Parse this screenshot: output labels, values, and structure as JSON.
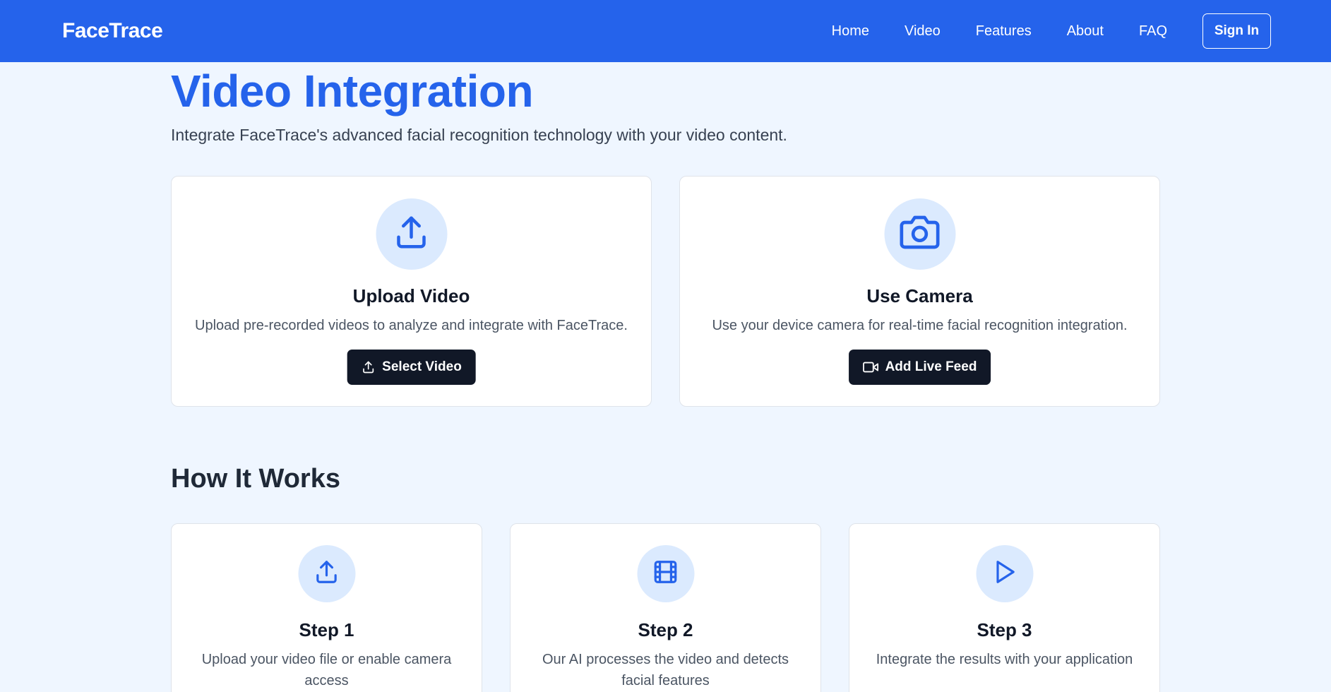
{
  "brand": "FaceTrace",
  "nav": {
    "links": [
      "Home",
      "Video",
      "Features",
      "About",
      "FAQ"
    ],
    "signin_label": "Sign In"
  },
  "header": {
    "title": "Video Integration",
    "subtitle": "Integrate FaceTrace's advanced facial recognition technology with your video content."
  },
  "options": {
    "upload": {
      "icon": "upload-icon",
      "title": "Upload Video",
      "description": "Upload pre-recorded videos to analyze and integrate with FaceTrace.",
      "button_label": "Select Video",
      "button_icon": "upload-icon"
    },
    "camera": {
      "icon": "camera-icon",
      "title": "Use Camera",
      "description": "Use your device camera for real-time facial recognition integration.",
      "button_label": "Add Live Feed",
      "button_icon": "video-camera-icon"
    }
  },
  "how_it_works": {
    "title": "How It Works",
    "steps": [
      {
        "icon": "upload-icon",
        "title": "Step 1",
        "description": "Upload your video file or enable camera access"
      },
      {
        "icon": "film-icon",
        "title": "Step 2",
        "description": "Our AI processes the video and detects facial features"
      },
      {
        "icon": "play-icon",
        "title": "Step 3",
        "description": "Integrate the results with your application"
      }
    ]
  },
  "colors": {
    "primary": "#2563eb",
    "background": "#eff6ff",
    "icon_circle": "#dbeafe",
    "button_dark": "#111827"
  }
}
